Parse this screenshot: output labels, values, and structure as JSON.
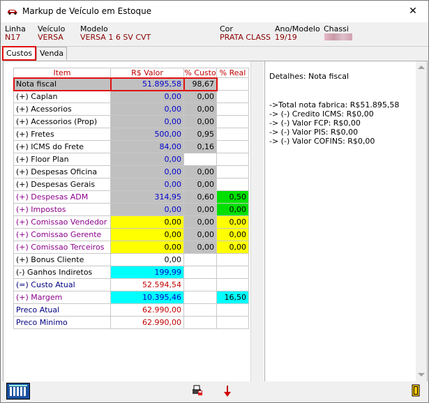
{
  "window": {
    "title": "Markup de Veículo em Estoque",
    "close_glyph": "✕"
  },
  "vehicle": {
    "linha_label": "Linha",
    "linha_value": "N17",
    "veiculo_label": "Veículo",
    "veiculo_value": "VERSA",
    "modelo_label": "Modelo",
    "modelo_value": "VERSA 1 6 SV CVT",
    "cor_label": "Cor",
    "cor_value": "PRATA CLASS",
    "ano_label": "Ano/Modelo",
    "ano_value": "19/19",
    "chassi_label": "Chassi"
  },
  "tabs": [
    {
      "label": "Custos",
      "active": true
    },
    {
      "label": "Venda",
      "active": false
    }
  ],
  "grid": {
    "headers": [
      "Item",
      "R$ Valor",
      "% Custo",
      "% Real"
    ],
    "rows": [
      {
        "item": "Nota fiscal",
        "valor": "51.895,58",
        "custo": "98,67",
        "real": ""
      },
      {
        "item": "(+) Caplan",
        "valor": "0,00",
        "custo": "0,00",
        "real": ""
      },
      {
        "item": "(+) Acessorios",
        "valor": "0,00",
        "custo": "0,00",
        "real": ""
      },
      {
        "item": "(+) Acessorios (Prop)",
        "valor": "0,00",
        "custo": "0,00",
        "real": ""
      },
      {
        "item": "(+) Fretes",
        "valor": "500,00",
        "custo": "0,95",
        "real": ""
      },
      {
        "item": "(+) ICMS do Frete",
        "valor": "84,00",
        "custo": "0,16",
        "real": ""
      },
      {
        "item": "(+) Floor Plan",
        "valor": "0,00",
        "custo": "",
        "real": ""
      },
      {
        "item": "(+) Despesas Oficina",
        "valor": "0,00",
        "custo": "0,00",
        "real": ""
      },
      {
        "item": "(+) Despesas Gerais",
        "valor": "0,00",
        "custo": "0,00",
        "real": ""
      },
      {
        "item": "(+) Despesas ADM",
        "valor": "314,95",
        "custo": "0,60",
        "real": "0,50"
      },
      {
        "item": "(+) Impostos",
        "valor": "0,00",
        "custo": "0,00",
        "real": "0,00"
      },
      {
        "item": "(+) Comissao Vendedor",
        "valor": "0,00",
        "custo": "0,00",
        "real": "0,00"
      },
      {
        "item": "(+) Comissao Gerente",
        "valor": "0,00",
        "custo": "0,00",
        "real": "0,00"
      },
      {
        "item": "(+) Comissao Terceiros",
        "valor": "0,00",
        "custo": "0,00",
        "real": "0,00"
      },
      {
        "item": "(+) Bonus Cliente",
        "valor": "0,00",
        "custo": "",
        "real": ""
      },
      {
        "item": "(-)  Ganhos Indiretos",
        "valor": "199,99",
        "custo": "",
        "real": ""
      },
      {
        "item": "(=) Custo Atual",
        "valor": "52.594,54",
        "custo": "",
        "real": ""
      },
      {
        "item": "(+) Margem",
        "valor": "10.395,46",
        "custo": "",
        "real": "16,50"
      },
      {
        "item": "Preco Atual",
        "valor": "62.990,00",
        "custo": "",
        "real": ""
      },
      {
        "item": "Preco Minimo",
        "valor": "62.990,00",
        "custo": "",
        "real": ""
      }
    ]
  },
  "details": {
    "heading": "Detalhes: Nota fiscal",
    "lines": [
      "->Total nota fabrica: R$51.895,58",
      "->  (-) Credito ICMS: R$0,00",
      "->  (-) Valor FCP: R$0,00",
      "->  (-) Valor PIS: R$0,00",
      "->  (-) Valor COFINS: R$0,00"
    ]
  },
  "icons": {
    "app": "car-icon",
    "calculator": "calculator-icon",
    "print": "print-icon",
    "down": "down-arrow-icon",
    "exit": "exit-door-icon"
  },
  "colors": {
    "accent_red": "#e01010",
    "value_red": "#c00000",
    "value_blue": "#0000cc",
    "gray_cell": "#c0c0c0",
    "yellow_cell": "#ffff00",
    "green_cell": "#00e000",
    "cyan_cell": "#00ffff"
  }
}
